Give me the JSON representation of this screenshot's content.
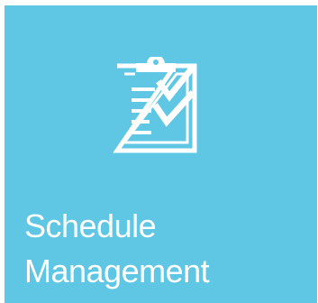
{
  "tile": {
    "label_line1": "Schedule",
    "label_line2": "Management",
    "icon": "clipboard-checklist-icon",
    "background_color": "#5fc6e4",
    "text_color": "#ffffff"
  }
}
